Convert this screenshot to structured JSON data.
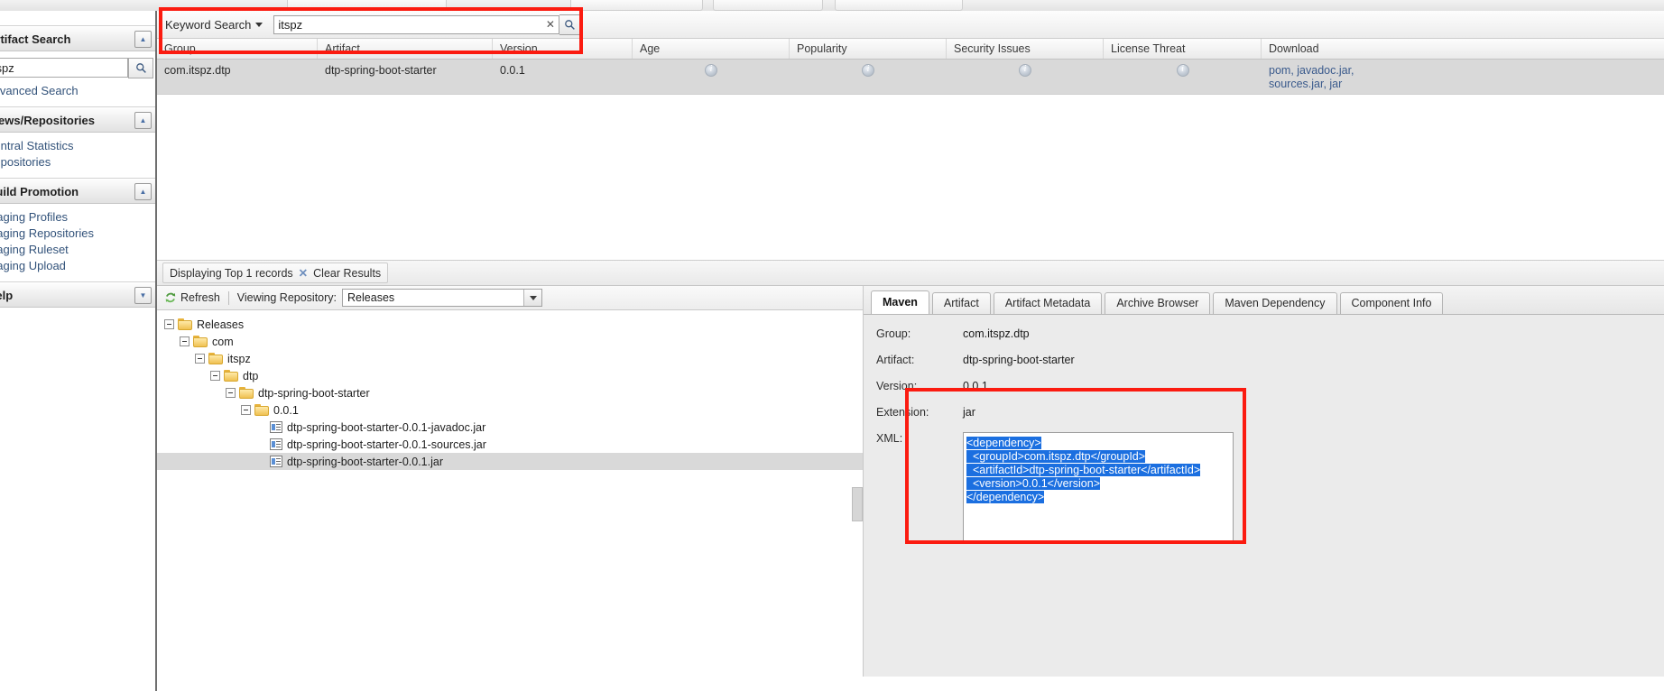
{
  "sidebar": {
    "sections": [
      {
        "title": "Artifact Search",
        "collapse_icon": "chevron-up-icon",
        "search_value": "itspz",
        "search_icon": "search-icon",
        "links": [
          "Advanced Search"
        ]
      },
      {
        "title": "Views/Repositories",
        "collapse_icon": "chevron-up-icon",
        "links": [
          "Central Statistics",
          "Repositories"
        ]
      },
      {
        "title": "Build Promotion",
        "collapse_icon": "chevron-up-icon",
        "links": [
          "Staging Profiles",
          "Staging Repositories",
          "Staging Ruleset",
          "Staging Upload"
        ]
      },
      {
        "title": "Help",
        "collapse_icon": "chevron-down-icon",
        "links": []
      }
    ]
  },
  "search": {
    "mode_label": "Keyword Search",
    "mode_caret": "caret-down-icon",
    "value": "itspz",
    "placeholder": "",
    "clear_icon": "✕",
    "search_icon": "search-icon"
  },
  "results": {
    "columns": [
      "Group",
      "Artifact",
      "Version",
      "Age",
      "Popularity",
      "Security Issues",
      "License Threat",
      "Download"
    ],
    "rows": [
      {
        "group": "com.itspz.dtp",
        "artifact": "dtp-spring-boot-starter",
        "version": "0.0.1",
        "age": "info-icon",
        "popularity": "info-icon",
        "security_issues": "info-icon",
        "license_threat": "info-icon",
        "download_links": [
          "pom,",
          "javadoc.jar,",
          "sources.jar,",
          "jar"
        ]
      }
    ],
    "status_text": "Displaying Top 1 records",
    "clear_x": "✕",
    "clear_label": "Clear Results"
  },
  "tree_toolbar": {
    "refresh_label": "Refresh",
    "refresh_icon": "refresh-icon",
    "viewing_label": "Viewing Repository:",
    "repository_value": "Releases",
    "dropdown_icon": "chevron-down-icon"
  },
  "tree": [
    {
      "label": "Releases",
      "depth": 0,
      "type": "folder",
      "expanded": true,
      "selected": false
    },
    {
      "label": "com",
      "depth": 1,
      "type": "folder",
      "expanded": true,
      "selected": false
    },
    {
      "label": "itspz",
      "depth": 2,
      "type": "folder",
      "expanded": true,
      "selected": false
    },
    {
      "label": "dtp",
      "depth": 3,
      "type": "folder",
      "expanded": true,
      "selected": false
    },
    {
      "label": "dtp-spring-boot-starter",
      "depth": 4,
      "type": "folder",
      "expanded": true,
      "selected": false
    },
    {
      "label": "0.0.1",
      "depth": 5,
      "type": "folder",
      "expanded": true,
      "selected": false
    },
    {
      "label": "dtp-spring-boot-starter-0.0.1-javadoc.jar",
      "depth": 6,
      "type": "file",
      "expanded": false,
      "selected": false
    },
    {
      "label": "dtp-spring-boot-starter-0.0.1-sources.jar",
      "depth": 6,
      "type": "file",
      "expanded": false,
      "selected": false
    },
    {
      "label": "dtp-spring-boot-starter-0.0.1.jar",
      "depth": 6,
      "type": "file",
      "expanded": false,
      "selected": true
    }
  ],
  "detail": {
    "tabs": [
      {
        "label": "Maven",
        "active": true
      },
      {
        "label": "Artifact",
        "active": false
      },
      {
        "label": "Artifact Metadata",
        "active": false
      },
      {
        "label": "Archive Browser",
        "active": false
      },
      {
        "label": "Maven Dependency",
        "active": false
      },
      {
        "label": "Component Info",
        "active": false
      }
    ],
    "fields": [
      {
        "label": "Group:",
        "value": "com.itspz.dtp"
      },
      {
        "label": "Artifact:",
        "value": "dtp-spring-boot-starter"
      },
      {
        "label": "Version:",
        "value": "0.0.1"
      },
      {
        "label": "Extension:",
        "value": "jar"
      }
    ],
    "xml_label": "XML:",
    "xml_lines": [
      "<dependency>",
      "  <groupId>com.itspz.dtp</groupId>",
      "  <artifactId>dtp-spring-boot-starter</artifactId>",
      "  <version>0.0.1</version>",
      "</dependency>"
    ]
  },
  "colors": {
    "annotation": "#fb1b10",
    "selection": "#1b6fe0",
    "link": "#3a5a8c",
    "row_highlight": "#d9d9d9"
  }
}
